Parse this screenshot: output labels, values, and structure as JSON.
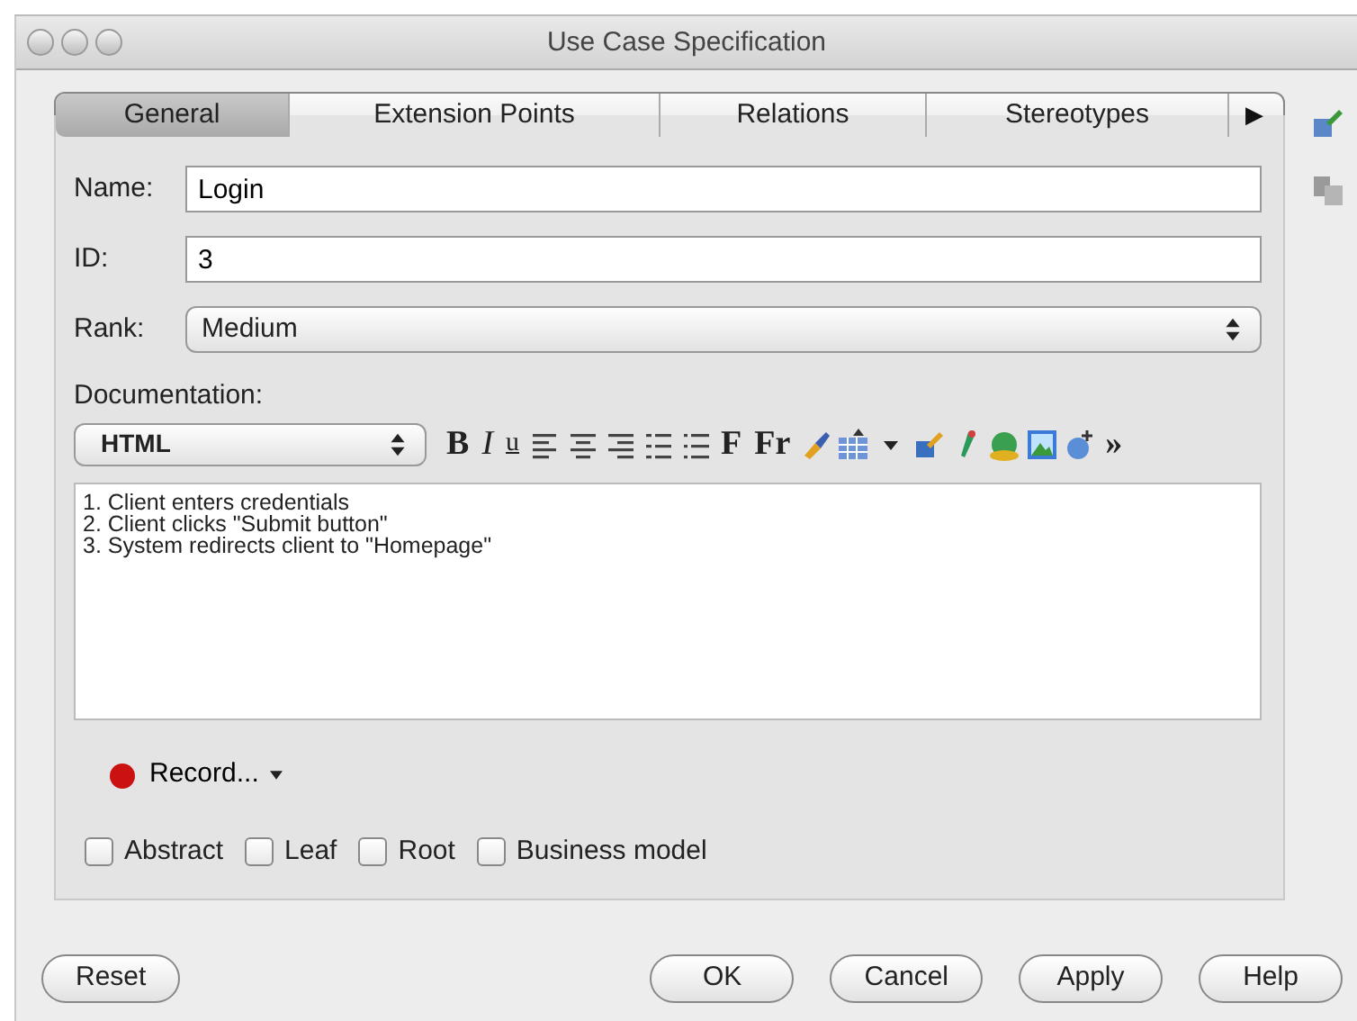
{
  "window": {
    "title": "Use Case Specification"
  },
  "tabs": [
    {
      "label": "General",
      "selected": true
    },
    {
      "label": "Extension Points",
      "selected": false
    },
    {
      "label": "Relations",
      "selected": false
    },
    {
      "label": "Stereotypes",
      "selected": false
    }
  ],
  "tabs_more": "▶",
  "fields": [
    {
      "label": "Name:",
      "kind": "text",
      "value": "Login"
    },
    {
      "label": "ID:",
      "kind": "text",
      "value": "3"
    },
    {
      "label": "Rank:",
      "kind": "select",
      "value": "Medium"
    }
  ],
  "documentation": {
    "label": "Documentation:",
    "format": "HTML",
    "style_glyphs": [
      "B",
      "I",
      "u"
    ],
    "font_glyphs": [
      "F",
      "Fr"
    ],
    "more": "»",
    "lines": [
      "1. Client enters credentials",
      "2. Client clicks \"Submit button\"",
      "3. System redirects client to \"Homepage\""
    ]
  },
  "record": {
    "label": "Record..."
  },
  "checkboxes": [
    {
      "label": "Abstract",
      "checked": false
    },
    {
      "label": "Leaf",
      "checked": false
    },
    {
      "label": "Root",
      "checked": false
    },
    {
      "label": "Business model",
      "checked": false
    }
  ],
  "buttons_left": [
    "Reset"
  ],
  "buttons_right": [
    "OK",
    "Cancel",
    "Apply",
    "Help"
  ]
}
